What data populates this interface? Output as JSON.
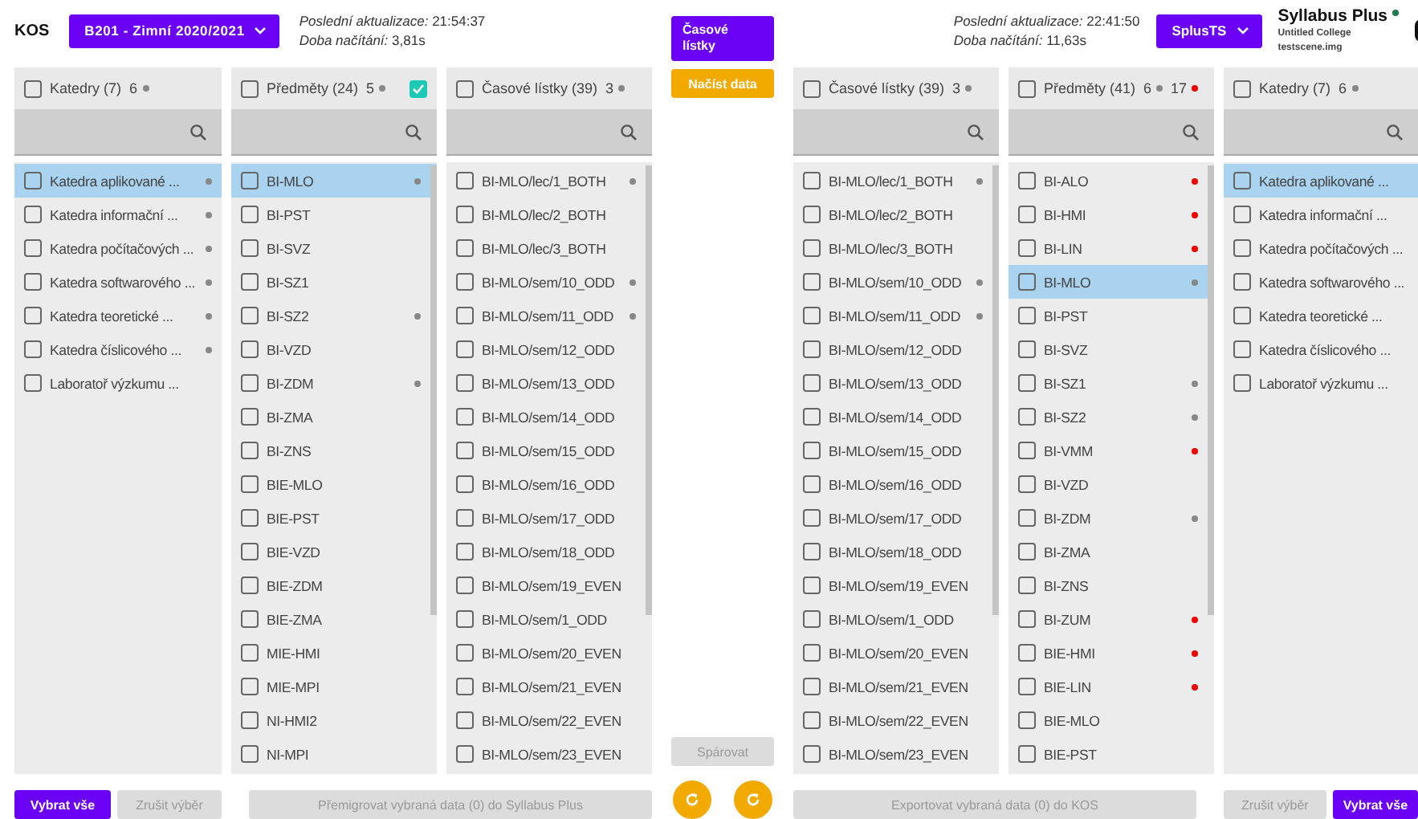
{
  "kos": {
    "title": "KOS",
    "semester": "B201 - Zimní 2020/2021",
    "update_label": "Poslední aktualizace:",
    "update_time": "21:54:37",
    "load_label": "Doba načítání:",
    "load_time": "3,81s"
  },
  "splus": {
    "update_label": "Poslední aktualizace:",
    "update_time": "22:41:50",
    "load_label": "Doba načítání:",
    "load_time": "11,63s",
    "source": "SplusTS",
    "title": "Syllabus Plus",
    "online": true,
    "college": "Untitled College",
    "file": "testscene.img"
  },
  "center": {
    "timetables_button": "Časové lístky",
    "load_button": "Načíst data",
    "pair_button": "Spárovat",
    "pair_disabled": true
  },
  "left_panels": [
    {
      "label": "Katedry (7)",
      "checked": false,
      "scrollable": false,
      "counts": [
        {
          "text": "6",
          "color": "#888888"
        }
      ],
      "items": [
        {
          "label": "Katedra aplikované ...",
          "checked": false,
          "selected": true,
          "color": "#888888"
        },
        {
          "label": "Katedra informační ...",
          "checked": false,
          "selected": false,
          "color": "#888888"
        },
        {
          "label": "Katedra počítačových ...",
          "checked": false,
          "selected": false,
          "color": "#888888"
        },
        {
          "label": "Katedra softwarového ...",
          "checked": false,
          "selected": false,
          "color": "#888888"
        },
        {
          "label": "Katedra teoretické ...",
          "checked": false,
          "selected": false,
          "color": "#888888"
        },
        {
          "label": "Katedra číslicového ...",
          "checked": false,
          "selected": false,
          "color": "#888888"
        },
        {
          "label": "Laboratoř výzkumu ...",
          "checked": false,
          "selected": false
        }
      ]
    },
    {
      "label": "Předměty (24)",
      "checked": false,
      "scrollable": true,
      "linked": true,
      "counts": [
        {
          "text": "5",
          "color": "#888888"
        }
      ],
      "items": [
        {
          "label": "BI-MLO",
          "checked": false,
          "selected": true,
          "color": "#888888"
        },
        {
          "label": "BI-PST",
          "checked": false,
          "selected": false
        },
        {
          "label": "BI-SVZ",
          "checked": false,
          "selected": false
        },
        {
          "label": "BI-SZ1",
          "checked": false,
          "selected": false
        },
        {
          "label": "BI-SZ2",
          "checked": false,
          "selected": false,
          "color": "#888888"
        },
        {
          "label": "BI-VZD",
          "checked": false,
          "selected": false
        },
        {
          "label": "BI-ZDM",
          "checked": false,
          "selected": false,
          "color": "#888888"
        },
        {
          "label": "BI-ZMA",
          "checked": false,
          "selected": false
        },
        {
          "label": "BI-ZNS",
          "checked": false,
          "selected": false
        },
        {
          "label": "BIE-MLO",
          "checked": false,
          "selected": false
        },
        {
          "label": "BIE-PST",
          "checked": false,
          "selected": false
        },
        {
          "label": "BIE-VZD",
          "checked": false,
          "selected": false
        },
        {
          "label": "BIE-ZDM",
          "checked": false,
          "selected": false
        },
        {
          "label": "BIE-ZMA",
          "checked": false,
          "selected": false
        },
        {
          "label": "MIE-HMI",
          "checked": false,
          "selected": false
        },
        {
          "label": "MIE-MPI",
          "checked": false,
          "selected": false
        },
        {
          "label": "NI-HMI2",
          "checked": false,
          "selected": false
        },
        {
          "label": "NI-MPI",
          "checked": false,
          "selected": false
        }
      ]
    },
    {
      "label": "Časové lístky (39)",
      "checked": false,
      "scrollable": true,
      "counts": [
        {
          "text": "3",
          "color": "#888888"
        }
      ],
      "items": [
        {
          "label": "BI-MLO/lec/1_BOTH",
          "checked": false,
          "selected": false,
          "color": "#888888"
        },
        {
          "label": "BI-MLO/lec/2_BOTH",
          "checked": false,
          "selected": false
        },
        {
          "label": "BI-MLO/lec/3_BOTH",
          "checked": false,
          "selected": false
        },
        {
          "label": "BI-MLO/sem/10_ODD",
          "checked": false,
          "selected": false,
          "color": "#888888"
        },
        {
          "label": "BI-MLO/sem/11_ODD",
          "checked": false,
          "selected": false,
          "color": "#888888"
        },
        {
          "label": "BI-MLO/sem/12_ODD",
          "checked": false,
          "selected": false
        },
        {
          "label": "BI-MLO/sem/13_ODD",
          "checked": false,
          "selected": false
        },
        {
          "label": "BI-MLO/sem/14_ODD",
          "checked": false,
          "selected": false
        },
        {
          "label": "BI-MLO/sem/15_ODD",
          "checked": false,
          "selected": false
        },
        {
          "label": "BI-MLO/sem/16_ODD",
          "checked": false,
          "selected": false
        },
        {
          "label": "BI-MLO/sem/17_ODD",
          "checked": false,
          "selected": false
        },
        {
          "label": "BI-MLO/sem/18_ODD",
          "checked": false,
          "selected": false
        },
        {
          "label": "BI-MLO/sem/19_EVEN",
          "checked": false,
          "selected": false
        },
        {
          "label": "BI-MLO/sem/1_ODD",
          "checked": false,
          "selected": false
        },
        {
          "label": "BI-MLO/sem/20_EVEN",
          "checked": false,
          "selected": false
        },
        {
          "label": "BI-MLO/sem/21_EVEN",
          "checked": false,
          "selected": false
        },
        {
          "label": "BI-MLO/sem/22_EVEN",
          "checked": false,
          "selected": false
        },
        {
          "label": "BI-MLO/sem/23_EVEN",
          "checked": false,
          "selected": false
        }
      ]
    }
  ],
  "right_panels": [
    {
      "label": "Časové lístky (39)",
      "checked": false,
      "scrollable": true,
      "counts": [
        {
          "text": "3",
          "color": "#888888"
        }
      ],
      "items": [
        {
          "label": "BI-MLO/lec/1_BOTH",
          "checked": false,
          "selected": false,
          "color": "#888888"
        },
        {
          "label": "BI-MLO/lec/2_BOTH",
          "checked": false,
          "selected": false
        },
        {
          "label": "BI-MLO/lec/3_BOTH",
          "checked": false,
          "selected": false
        },
        {
          "label": "BI-MLO/sem/10_ODD",
          "checked": false,
          "selected": false,
          "color": "#888888"
        },
        {
          "label": "BI-MLO/sem/11_ODD",
          "checked": false,
          "selected": false,
          "color": "#888888"
        },
        {
          "label": "BI-MLO/sem/12_ODD",
          "checked": false,
          "selected": false
        },
        {
          "label": "BI-MLO/sem/13_ODD",
          "checked": false,
          "selected": false
        },
        {
          "label": "BI-MLO/sem/14_ODD",
          "checked": false,
          "selected": false
        },
        {
          "label": "BI-MLO/sem/15_ODD",
          "checked": false,
          "selected": false
        },
        {
          "label": "BI-MLO/sem/16_ODD",
          "checked": false,
          "selected": false
        },
        {
          "label": "BI-MLO/sem/17_ODD",
          "checked": false,
          "selected": false
        },
        {
          "label": "BI-MLO/sem/18_ODD",
          "checked": false,
          "selected": false
        },
        {
          "label": "BI-MLO/sem/19_EVEN",
          "checked": false,
          "selected": false
        },
        {
          "label": "BI-MLO/sem/1_ODD",
          "checked": false,
          "selected": false
        },
        {
          "label": "BI-MLO/sem/20_EVEN",
          "checked": false,
          "selected": false
        },
        {
          "label": "BI-MLO/sem/21_EVEN",
          "checked": false,
          "selected": false
        },
        {
          "label": "BI-MLO/sem/22_EVEN",
          "checked": false,
          "selected": false
        },
        {
          "label": "BI-MLO/sem/23_EVEN",
          "checked": false,
          "selected": false
        }
      ]
    },
    {
      "label": "Předměty (41)",
      "checked": false,
      "scrollable": true,
      "counts": [
        {
          "text": "6",
          "color": "#888888"
        },
        {
          "text": "17",
          "color": "#ee0000"
        }
      ],
      "items": [
        {
          "label": "BI-ALO",
          "checked": false,
          "selected": false,
          "color": "#ee0000"
        },
        {
          "label": "BI-HMI",
          "checked": false,
          "selected": false,
          "color": "#ee0000"
        },
        {
          "label": "BI-LIN",
          "checked": false,
          "selected": false,
          "color": "#ee0000"
        },
        {
          "label": "BI-MLO",
          "checked": false,
          "selected": true,
          "color": "#888888"
        },
        {
          "label": "BI-PST",
          "checked": false,
          "selected": false
        },
        {
          "label": "BI-SVZ",
          "checked": false,
          "selected": false
        },
        {
          "label": "BI-SZ1",
          "checked": false,
          "selected": false,
          "color": "#888888"
        },
        {
          "label": "BI-SZ2",
          "checked": false,
          "selected": false,
          "color": "#888888"
        },
        {
          "label": "BI-VMM",
          "checked": false,
          "selected": false,
          "color": "#ee0000"
        },
        {
          "label": "BI-VZD",
          "checked": false,
          "selected": false
        },
        {
          "label": "BI-ZDM",
          "checked": false,
          "selected": false,
          "color": "#888888"
        },
        {
          "label": "BI-ZMA",
          "checked": false,
          "selected": false
        },
        {
          "label": "BI-ZNS",
          "checked": false,
          "selected": false
        },
        {
          "label": "BI-ZUM",
          "checked": false,
          "selected": false,
          "color": "#ee0000"
        },
        {
          "label": "BIE-HMI",
          "checked": false,
          "selected": false,
          "color": "#ee0000"
        },
        {
          "label": "BIE-LIN",
          "checked": false,
          "selected": false,
          "color": "#ee0000"
        },
        {
          "label": "BIE-MLO",
          "checked": false,
          "selected": false
        },
        {
          "label": "BIE-PST",
          "checked": false,
          "selected": false
        }
      ]
    },
    {
      "label": "Katedry (7)",
      "checked": false,
      "scrollable": false,
      "counts": [
        {
          "text": "6",
          "color": "#888888"
        }
      ],
      "items": [
        {
          "label": "Katedra aplikované ...",
          "checked": false,
          "selected": true
        },
        {
          "label": "Katedra informační ...",
          "checked": false,
          "selected": false
        },
        {
          "label": "Katedra počítačových ...",
          "checked": false,
          "selected": false
        },
        {
          "label": "Katedra softwarového ...",
          "checked": false,
          "selected": false
        },
        {
          "label": "Katedra teoretické ...",
          "checked": false,
          "selected": false
        },
        {
          "label": "Katedra číslicového ...",
          "checked": false,
          "selected": false
        },
        {
          "label": "Laboratoř výzkumu ...",
          "checked": false,
          "selected": false
        }
      ]
    }
  ],
  "left_actions": {
    "select_all": {
      "label": "Vybrat vše",
      "disabled": false
    },
    "clear": {
      "label": "Zrušit výběr",
      "disabled": true
    },
    "migrate": {
      "label": "Přemigrovat vybraná data (0) do Syllabus Plus",
      "disabled": true
    }
  },
  "right_actions": {
    "export": {
      "label": "Exportovat vybraná data (0) do KOS",
      "disabled": true
    },
    "clear": {
      "label": "Zrušit výběr",
      "disabled": true
    },
    "select_all": {
      "label": "Vybrat vše",
      "disabled": false
    }
  }
}
